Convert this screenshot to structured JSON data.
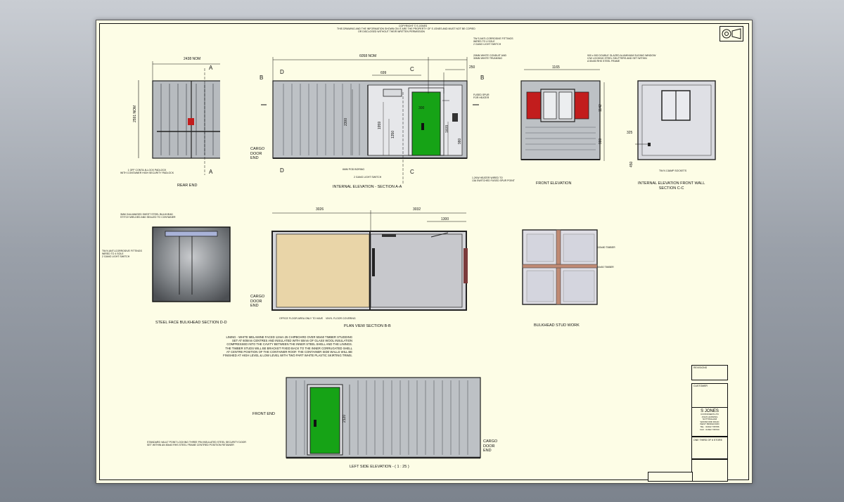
{
  "header": {
    "line1": "COPYRIGHT © S JONES",
    "line2": "THIS DRAWING AND THE INFORMATION SHOWN ON IT ARE THE PROPERTY OF S JONES AND MUST NOT BE COPIED",
    "line3": "OR DISCLOSED WITHOUT THEIR WRITTEN PERMISSION"
  },
  "views": {
    "rear_end": {
      "title": "REAR END",
      "dim_width": "2438 NOM",
      "dim_height": "2591 NOM",
      "section_mark": "A",
      "note": "1 OFF CONTA-N-LOCK PADLOCK\nWITH CONTAINER HIGH SECURITY PADLOCK"
    },
    "internal_elevation": {
      "title": "INTERNAL ELEVATION - SECTION A-A",
      "dim_overall": "6058 NOM",
      "dim_699": "699",
      "dim_250": "250",
      "dim_2300": "2300",
      "dim_1959": "1959",
      "dim_1350": "1350",
      "dim_1609": "1609",
      "dim_980": "980",
      "dim_300": "300",
      "mark_b": "B",
      "mark_c": "C",
      "mark_d": "D",
      "cargo_door": "CARGO\nDOOR\nEND",
      "note_1": "TW S ANTI-CORROSIVE FITTINGS\nWIRED TO 4 SOLE\n2 GANG LIGHT SWITCH",
      "note_2": "20MM WHITE CONDUIT AND\n30MM WHITE TRUNKING",
      "note_3": "FUSED SPUR\nFOR HEATER",
      "note_4": "6MM POD BORING",
      "note_5": "2 GANG LIGHT SWITCH",
      "note_6": "1.2KW HEATER WIRED TO\n13A SWITCHED FUSED SPUR POINT"
    },
    "front_elevation": {
      "title": "FRONT ELEVATION",
      "dim_1165": "1165",
      "dim_1142": "1142",
      "dim_980": "980",
      "note": "900 x 900 DOUBLE GLAZED ALUMINIUM SLIDING WINDOW\nC/W LOCKING STEEL SHUTTERS AND SET WITHIN\nA 50x50 RHS STEEL FRAME"
    },
    "internal_front_wall": {
      "title": "INTERNAL ELEVATION FRONT WALL\nSECTION C-C",
      "dim_325": "325",
      "dim_450": "450",
      "note": "TW N 13AMP SOCKETS"
    },
    "bulkhead_section": {
      "title": "STEEL FACE BULKHEAD SECTION D-D",
      "note_1": "3MM GALVANISED SHEET STEEL BULKHEAD\nSTITCH WELDED AND SEALED TO CONTAINER",
      "note_2": "TW N ANTI-CORROSIVE FITTINGS\nWIRED TO 4 SOLE\n2 GANG LIGHT SWITCH"
    },
    "plan_view": {
      "title": "PLAN VIEW SECTION B-B",
      "dim_3026": "3026",
      "dim_3032": "3032",
      "dim_1300": "1300",
      "cargo_door": "CARGO\nDOOR\nEND",
      "note": "OFFICE FLOOR AREA ONLY TO HAVE    VINYL FLOOR COVERING"
    },
    "bulkhead_stud": {
      "title": "BULKHEAD STUD WORK",
      "label_1": "100x50 TIMBER",
      "label_2": "50x50 TIMBER"
    },
    "left_side": {
      "title": "LEFT SIDE ELEVATION - ( 1 : 25 )",
      "dim_2120": "2120",
      "front_end": "FRONT END",
      "cargo_door": "CARGO\nDOOR\nEND",
      "note": "STANDARD VAULT POINT LOCKING THREE PIN INSULATED STEEL SECURITY DOOR\nSET WITHIN AN 80x40 RHS STEEL FRAME CENTRED POSITION RETAINER"
    }
  },
  "notes_text": "LINING - WHITE MELAMINE FACED 12mm 25 CHIPBOARD OVER 50x50 TIMBER STUDDING SET AT 600mm CENTRES AND INSULATED WITH 50mm OF GLASS WOOL INSULATION COMPRESSED INTO THE CAVITY BETWEEN THE INNER STEEL SHELL AND THE LININGS. THE TIMBER STUDS WILL BE BRACKET FIXED BACK TO THE INNER CORRUGATED SHELL AT CENTRE POSITION OF THE CONTAINER ROOF. THE CONTAINER SIDE WALLS WILL BE FINISHED AT HIGH LEVEL & LOW LEVEL WITH TWO PART WHITE PLASTIC SKIRTING TRIMS.",
  "title_block": {
    "company": "S JONES",
    "address": "CONTAINERS LTD\nJOHN HANNING\nNOTTINGHAM\nWANSFORD ROAD\nWEST BRIDGFORD",
    "phone": "TEL : 01602 795786\nFAX : 01602 795700",
    "drawing_title": "ONE THIRD OF 6 STORE",
    "customer_label": "CUSTOMER",
    "revision_label": "REVISIONS"
  },
  "colors": {
    "door": "#16a316",
    "shutter": "#c21d1d",
    "plan_floor": "#e9d5a8",
    "wall": "#c0c4c8"
  }
}
